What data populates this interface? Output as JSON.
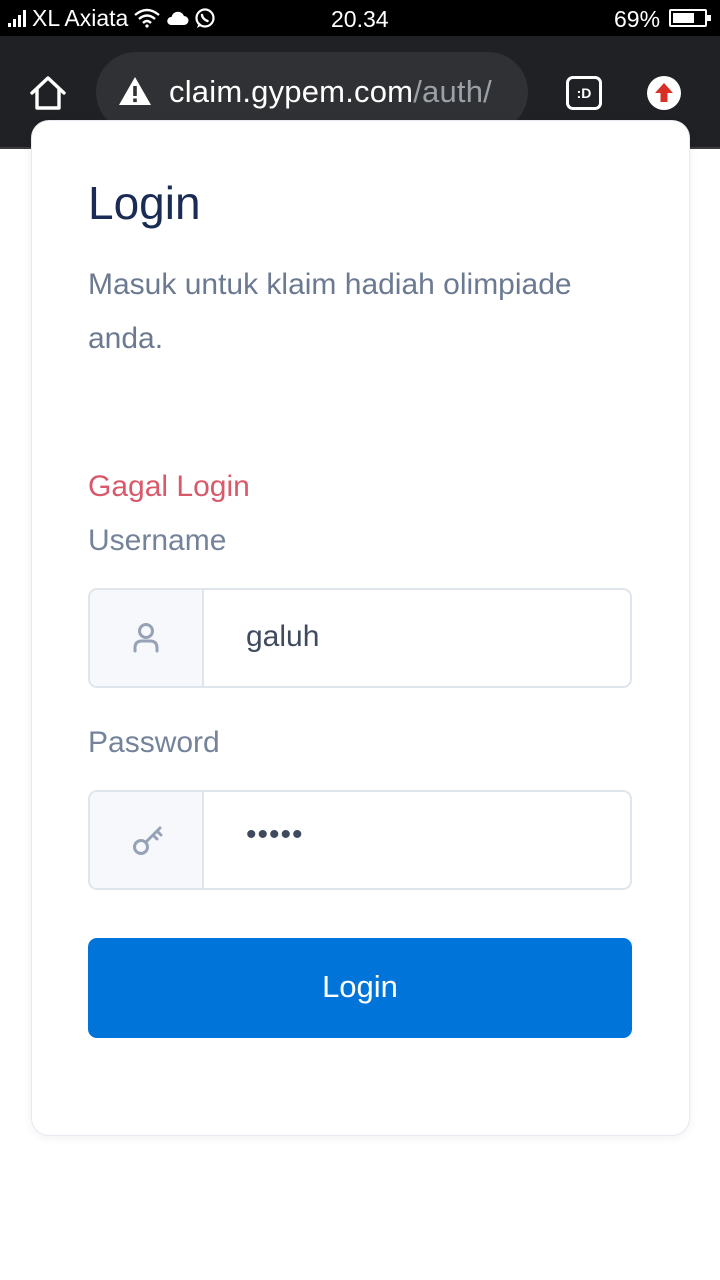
{
  "status_bar": {
    "carrier": "XL Axiata",
    "time": "20.34",
    "battery_percent": "69%",
    "battery_level": 0.69,
    "icons": [
      "signal-icon",
      "wifi-icon",
      "cloud-icon",
      "whatsapp-icon",
      "battery-icon"
    ]
  },
  "browser": {
    "url_host": "claim.gypem.com",
    "url_path": "/auth/",
    "tabs_label": ":D",
    "icons": [
      "home-icon",
      "warning-icon",
      "tab-switcher-icon",
      "update-arrow-icon"
    ],
    "colors": {
      "toolbar": "#202124",
      "url_box": "#303134",
      "update_badge": "#d93025"
    }
  },
  "login_card": {
    "title": "Login",
    "subtitle": "Masuk untuk klaim hadiah olimpiade anda.",
    "error": "Gagal Login",
    "username": {
      "label": "Username",
      "value": "galuh",
      "icon": "user-icon"
    },
    "password": {
      "label": "Password",
      "value": "•••••",
      "icon": "key-icon"
    },
    "submit_label": "Login",
    "colors": {
      "title": "#1a2c55",
      "error": "#d9596b",
      "button": "#0074d9"
    }
  }
}
